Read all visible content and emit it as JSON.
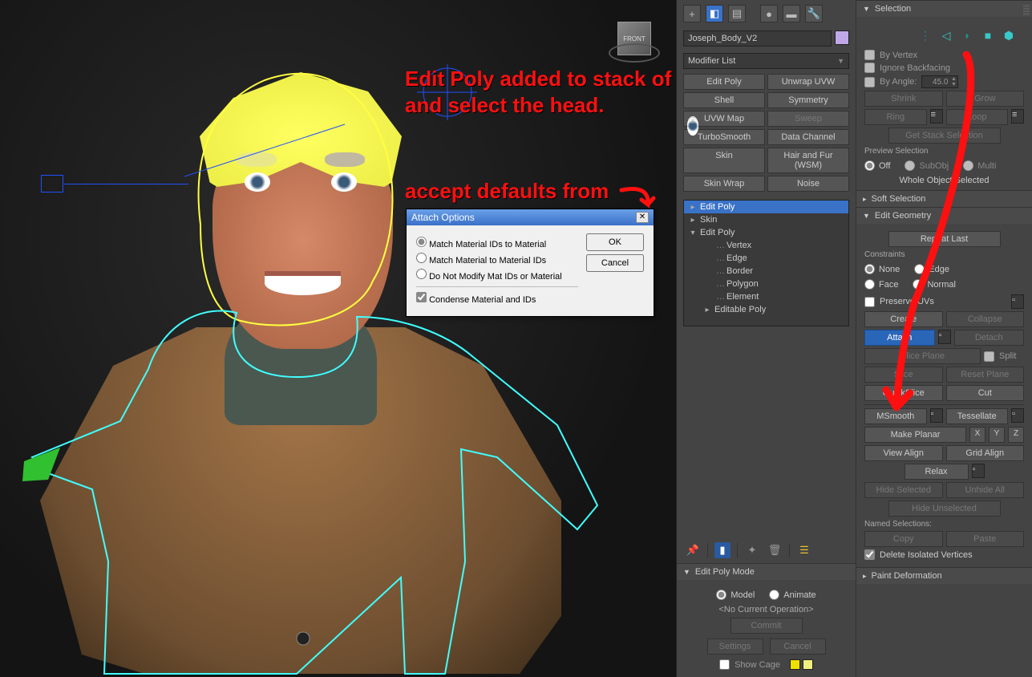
{
  "viewport": {
    "viewcube_face": "FRONT",
    "annotation1": "Edit Poly added to stack of body mesh and click attach and select the head.",
    "annotation2": "accept defaults from"
  },
  "dialog": {
    "title": "Attach Options",
    "opts": {
      "o1": "Match Material IDs to Material",
      "o2": "Match Material to Material IDs",
      "o3": "Do Not Modify Mat IDs or Material",
      "ck": "Condense Material and IDs"
    },
    "ok": "OK",
    "cancel": "Cancel"
  },
  "cmd": {
    "object_name": "Joseph_Body_V2",
    "mod_list": "Modifier List",
    "modbuttons": [
      "Edit Poly",
      "Unwrap UVW",
      "Shell",
      "Symmetry",
      "UVW Map",
      "Sweep",
      "TurboSmooth",
      "Data Channel",
      "Skin",
      "Hair and Fur (WSM)",
      "Skin Wrap",
      "Noise"
    ],
    "stack": {
      "r1": "Edit Poly",
      "r2": "Skin",
      "r3": "Edit Poly",
      "subs": [
        "Vertex",
        "Edge",
        "Border",
        "Polygon",
        "Element"
      ],
      "r4": "Editable Poly"
    },
    "editpolymode": {
      "title": "Edit Poly Mode",
      "model": "Model",
      "animate": "Animate",
      "noop": "<No Current Operation>",
      "commit": "Commit",
      "settings": "Settings",
      "cancel": "Cancel",
      "showcage": "Show Cage"
    }
  },
  "side": {
    "selection": {
      "title": "Selection",
      "byvertex": "By Vertex",
      "ignore": "Ignore Backfacing",
      "byangle": "By Angle:",
      "angle": "45.0",
      "shrink": "Shrink",
      "grow": "Grow",
      "ring": "Ring",
      "loop": "Loop",
      "getstack": "Get Stack Selection",
      "preview": "Preview Selection",
      "off": "Off",
      "subobj": "SubObj",
      "multi": "Multi",
      "status": "Whole Object Selected"
    },
    "softsel": "Soft Selection",
    "editgeo": {
      "title": "Edit Geometry",
      "repeat": "Repeat Last",
      "constraints": "Constraints",
      "none": "None",
      "edge": "Edge",
      "face": "Face",
      "normal": "Normal",
      "preserve": "Preserve UVs",
      "create": "Create",
      "collapse": "Collapse",
      "attach": "Attach",
      "detach": "Detach",
      "sliceplane": "Slice Plane",
      "split": "Split",
      "slice": "Slice",
      "reset": "Reset Plane",
      "quick": "QuickSlice",
      "cut": "Cut",
      "msmooth": "MSmooth",
      "tess": "Tessellate",
      "planar": "Make Planar",
      "x": "X",
      "y": "Y",
      "z": "Z",
      "valign": "View Align",
      "galign": "Grid Align",
      "relax": "Relax",
      "hidesel": "Hide Selected",
      "unhide": "Unhide All",
      "hideun": "Hide Unselected",
      "named": "Named Selections:",
      "copy": "Copy",
      "paste": "Paste",
      "deliso": "Delete Isolated Vertices"
    },
    "paint": "Paint Deformation"
  }
}
